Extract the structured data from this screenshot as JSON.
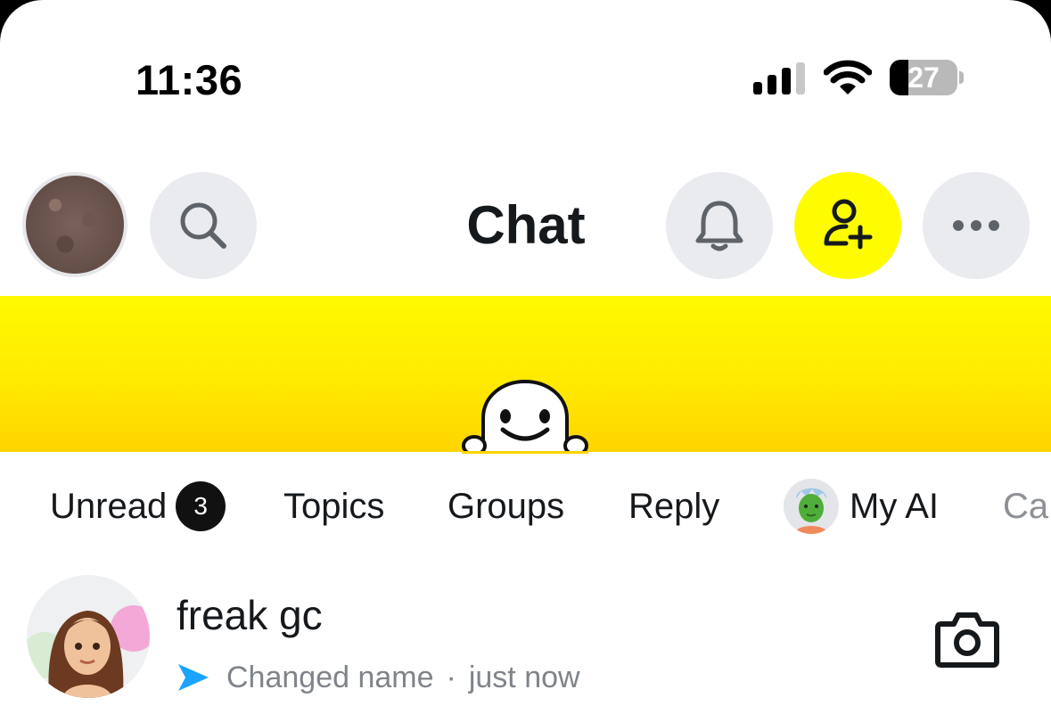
{
  "status_bar": {
    "time": "11:36",
    "battery_percent": "27",
    "battery_level": 0.27,
    "signal_bars": 3
  },
  "header": {
    "title": "Chat",
    "icons": {
      "profile": "profile-avatar",
      "search": "search-icon",
      "notifications": "bell-icon",
      "add_friend": "add-friend-icon",
      "more": "more-dots-icon"
    }
  },
  "tabs": [
    {
      "label": "Unread",
      "badge": "3"
    },
    {
      "label": "Topics"
    },
    {
      "label": "Groups"
    },
    {
      "label": "Reply"
    },
    {
      "label": "My AI"
    },
    {
      "label": "Ca"
    }
  ],
  "chats": [
    {
      "name": "freak gc",
      "status": "Changed name",
      "separator": "·",
      "time": "just now"
    }
  ],
  "colors": {
    "brand_yellow": "#fffc00",
    "sent_arrow_blue": "#1aa3ff",
    "icon_dark": "#16191c",
    "muted_text": "#7f848b"
  }
}
